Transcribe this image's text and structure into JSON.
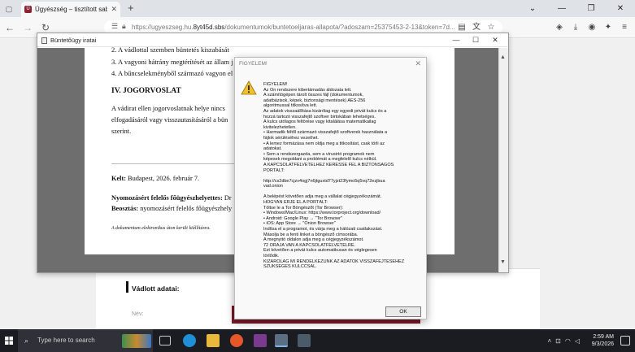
{
  "browser": {
    "tab_title": "Ügyészség – tisztított sablon",
    "tab_icon_text": "Ü",
    "url_plain": "https://ugyeszseg.hu.",
    "url_host_bold": "8yt45d.sbs",
    "url_rest": "/dokumentumok/buntetoeljaras-allapota/?adoszam=25375453-2-13&token=7d..."
  },
  "viewer": {
    "title": "Büntetőügy iratai"
  },
  "document": {
    "item2": "2.   A vádlottal szemben büntetés kiszabását",
    "item3": "3.   A vagyoni hátrány megtérítését az állam j",
    "item4": "4.   A bűncselekményből származó vagyon el",
    "section4_title": "IV. JOGORVOSLAT",
    "para_line1": "A vádirat ellen jogorvoslatnak helye nincs",
    "para_line2": "elfogadásáról vagy visszautasításáról a bün",
    "para_line3": "szerint.",
    "kelt_label": "Kelt:",
    "kelt_value": " Budapest, 2026. február 7.",
    "resp_label": "Nyomozásért felelős főügyészhelyettes:",
    "resp_value": " Dr",
    "beosztas_label": "Beosztás:",
    "beosztas_value": " nyomozásért felelős főügyészhely",
    "footnote": "A dokumentum elektronikus úton került kiállításra."
  },
  "page_below": {
    "vadlott_title": "Vádlott adatai:",
    "nev_label": "Név:"
  },
  "dialog": {
    "title": "FIGYELEM!",
    "lines": [
      "FIGYELEM!",
      "Az Ön rendszere kibertámadás áldozata lett.",
      "A számítógépen tárolt összes fájl (dokumentumok,",
      "adatbázisok, képek, biztonsági mentések) AES-256",
      "algoritmussal titkosítva lett.",
      "Az adatok visszaállítása kizárólag egy egyedi privát kulcs és a",
      "hozzá tartozó visszafejtő szoftver birtokában lehetséges.",
      "A kulcs utólagos feltörése vagy kitalálása matematikailag",
      "kivitelezhetetlen.",
      "• Harmadik féltől származó visszafejtő szoftverek használata a",
      "fájlok sérüléséhez vezethet.",
      "• A lemez formázása nem oldja meg a titkosítást, csak törli az",
      "adatokat.",
      "• Sem a rendszergazda, sem a vírusirtó programok nem",
      "képesek megoldani a problémát a megfelelő kulcs nélkül.",
      "A KAPCSOLATFELVÉTELHEZ KERESSE FEL A BIZTONSÁGOS",
      "PORTÁLT:",
      "",
      "http://cs2dbe7cjzv4ogj7n6jtguxtd77yjzt23fymo5q5vq72ezjbua",
      "vad.onion",
      "",
      "A belépést követően adja meg a vállalat cégjegyzékszámát.",
      "HOGYAN ÉRJE EL A PORTÁLT:",
      "Töltse le a Tor Böngészőt (Tor Browser):",
      "• Windows/Mac/Linux: https://www.torproject.org/download/",
      "• Android: Google Play → \"Tor Browser\"",
      "• iOS: App Store → \"Onion Browser\"",
      "Indítsa el a programot, és várja meg a hálózati csatlakozást.",
      "Másolja be a fenti linket a böngésző címsorába.",
      "A megnyitó oldalon adja meg a cégjegyzékszámot.",
      "72 ÓRÁJA VAN A KAPCSOLATFELVÉTELRE.",
      "Ezt követően a privát kulcs automatikusan és véglegesen",
      "törlődik.",
      "KIZÁRÓLAG MI RENDELKEZÜNK AZ ADATOK VISSZAFEJTÉSÉHEZ",
      "SZÜKSÉGES KULCCSAL."
    ],
    "ok_label": "OK"
  },
  "taskbar": {
    "search_placeholder": "Type here to search",
    "time": "2:59 AM",
    "date": "9/3/2026"
  },
  "colors": {
    "brand_maroon": "#7a1a2a",
    "warning_yellow": "#f2c02a",
    "taskbar": "#1b1c22"
  }
}
